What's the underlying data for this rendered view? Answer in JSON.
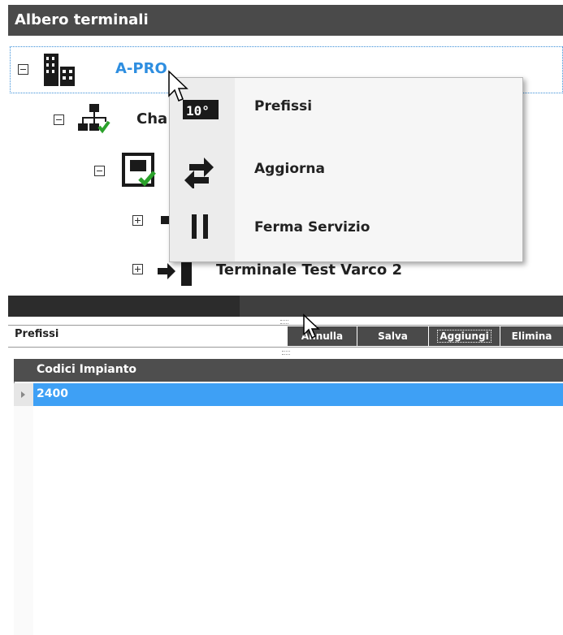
{
  "tree": {
    "header_title": "Albero terminali",
    "root": {
      "label": "A-PRO"
    },
    "channel": {
      "label": "Cha"
    },
    "terminal_last": {
      "label": "Terminale Test Varco 2"
    }
  },
  "context_menu": {
    "items": [
      {
        "label": "Prefissi",
        "icon": "prefix-digits-icon"
      },
      {
        "label": "Aggiorna",
        "icon": "refresh-icon"
      },
      {
        "label": "Ferma Servizio",
        "icon": "pause-icon"
      }
    ]
  },
  "panel": {
    "title": "Prefissi",
    "buttons": {
      "annulla": "Annulla",
      "salva": "Salva",
      "aggiungi": "Aggiungi",
      "elimina": "Elimina"
    }
  },
  "grid": {
    "column_header": "Codici Impianto",
    "rows": [
      "2400"
    ]
  },
  "colors": {
    "selected_row": "#3ea0f5",
    "root_label": "#2e8ee0",
    "header_bg": "#4a4a4a"
  }
}
